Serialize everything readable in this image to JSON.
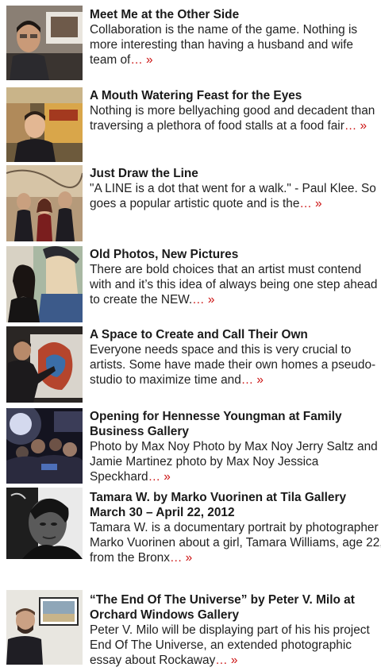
{
  "accent_color": "#cc1111",
  "posts": [
    {
      "title": "Meet Me at the Other Side",
      "excerpt": "Collaboration is the name of the game. Nothing is more interesting than having a husband and wife team of",
      "more": "… »",
      "thumb_alt": "photo-man-with-artwork"
    },
    {
      "title": "A Mouth Watering Feast for the Eyes",
      "excerpt": "Nothing is more bellyaching good and decadent than traversing a plethora of food stalls at a food fair",
      "more": "… »",
      "thumb_alt": "photo-man-at-food-stall"
    },
    {
      "title": "Just Draw the Line",
      "excerpt": "\"A LINE is a dot that went for a walk.\" - Paul Klee. So goes a popular artistic quote and is the",
      "more": "… »",
      "thumb_alt": "photo-three-people-gallery"
    },
    {
      "title": "Old Photos, New Pictures",
      "excerpt": "There are bold choices that an artist must contend with and it’s this idea of always being one step ahead to create the NEW.",
      "more": "… »",
      "thumb_alt": "photo-woman-with-painting"
    },
    {
      "title": "A Space to Create and Call Their Own",
      "excerpt": "Everyone needs space and this is very crucial to artists. Some have made their own homes a pseudo-studio to maximize time and",
      "more": "… »",
      "thumb_alt": "photo-artist-painting"
    },
    {
      "title": "Opening for Hennesse Youngman at Family Business Gallery",
      "excerpt": "Photo by Max Noy Photo by Max Noy Jerry Saltz and Jamie Martinez photo by Max Noy Jessica Speckhard",
      "more": "… »",
      "thumb_alt": "photo-crowd-at-opening"
    },
    {
      "title": "Tamara W. by Marko Vuorinen at Tila Gallery March 30 – April 22, 2012",
      "excerpt": " Tamara W. is a documentary portrait by photographer Marko Vuorinen about a girl, Tamara Williams, age 22,  from the Bronx",
      "more": "… »",
      "thumb_alt": "photo-black-and-white-portrait"
    },
    {
      "title": "“The End Of The Universe” by Peter V. Milo at Orchard Windows Gallery",
      "excerpt": " Peter V. Milo will be displaying part of his his project End Of The Universe, an extended photographic essay about Rockaway",
      "more": "… »",
      "thumb_alt": "photo-man-beside-framed-photo"
    }
  ]
}
